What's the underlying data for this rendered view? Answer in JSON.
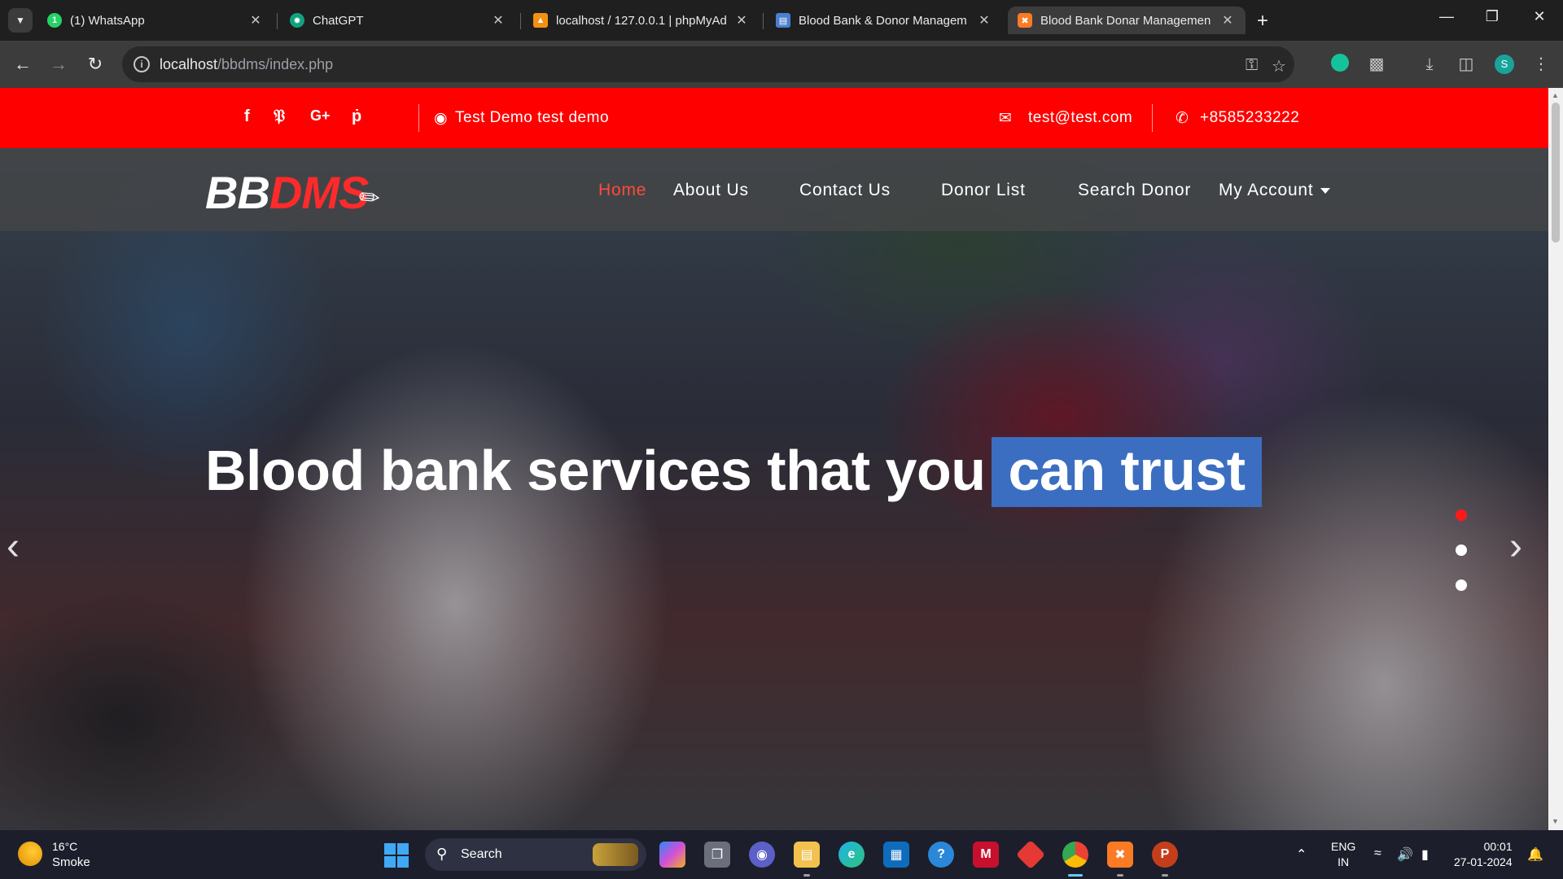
{
  "browser": {
    "tabs": [
      {
        "title": "(1) WhatsApp",
        "favicon": "whatsapp-icon",
        "color": "#25d366"
      },
      {
        "title": "ChatGPT",
        "favicon": "chatgpt-icon",
        "color": "#10a37f"
      },
      {
        "title": "localhost / 127.0.0.1 | phpMyAd",
        "favicon": "phpmyadmin-icon",
        "color": "#f29111"
      },
      {
        "title": "Blood Bank & Donor Managem",
        "favicon": "page-icon",
        "color": "#4a7fd1"
      },
      {
        "title": "Blood Bank Donar Managemen",
        "favicon": "xampp-icon",
        "color": "#fb7a24"
      }
    ],
    "url_host": "localhost",
    "url_path": "/bbdms/index.php",
    "profile_initial": "S"
  },
  "site": {
    "topbar": {
      "address": "Test Demo test demo",
      "email": "test@test.com",
      "phone": "+8585233222",
      "social_icons": [
        "facebook-icon",
        "twitter-icon",
        "google-plus-icon",
        "pinterest-icon"
      ]
    },
    "logo": {
      "part1": "BB",
      "part2": "DMS"
    },
    "nav": {
      "home": "Home",
      "about": "About Us",
      "contact": "Contact Us",
      "donor_list": "Donor List",
      "search_donor": "Search Donor",
      "my_account": "My Account"
    },
    "hero": {
      "headline_main": "Blood bank services that you",
      "headline_highlight": "can trust",
      "slide_count": 3,
      "active_slide": 1
    },
    "colors": {
      "brand_red": "#ff0000",
      "highlight_blue": "#3b6ec1"
    }
  },
  "taskbar": {
    "weather_temp": "16°C",
    "weather_desc": "Smoke",
    "search_label": "Search",
    "lang_line1": "ENG",
    "lang_line2": "IN",
    "time": "00:01",
    "date": "27-01-2024"
  }
}
